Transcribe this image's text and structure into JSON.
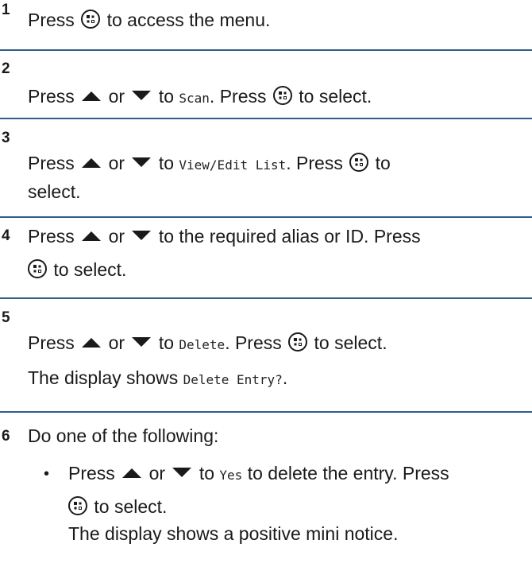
{
  "steps": [
    {
      "number": "1",
      "text_a": "Press",
      "text_b": "to access the menu."
    },
    {
      "number": "2",
      "text_a": "Press",
      "text_or": "or",
      "text_to": "to",
      "item": "Scan",
      "text_c": ". Press",
      "text_d": "to select."
    },
    {
      "number": "3",
      "text_a": "Press",
      "text_or": "or",
      "text_to": "to",
      "item": "View/Edit List",
      "text_c": ". Press",
      "text_d": "to",
      "line2": "select."
    },
    {
      "number": "4",
      "text_a": "Press",
      "text_or": "or",
      "text_b": "to the required alias or ID. Press",
      "line2": "to select."
    },
    {
      "number": "5",
      "text_a": "Press",
      "text_or": "or",
      "text_to": "to",
      "item": "Delete",
      "text_c": ". Press",
      "text_d": "to select.",
      "result_a": "The display shows",
      "result_item": "Delete Entry?",
      "result_b": "."
    },
    {
      "number": "6",
      "text": "Do one of the following:",
      "bullet": "•",
      "b_a": "Press",
      "b_or": "or",
      "b_to": "to",
      "b_item": "Yes",
      "b_b": "to delete the entry. Press",
      "b_line2": "to select.",
      "b_line3": "The display shows a positive mini notice."
    }
  ],
  "icons": {
    "menu_button": "menu-ok-button-icon",
    "up": "up-arrow-icon",
    "down": "down-arrow-icon"
  },
  "colors": {
    "rule": "#2f5d8a",
    "text": "#1a1a1a"
  }
}
